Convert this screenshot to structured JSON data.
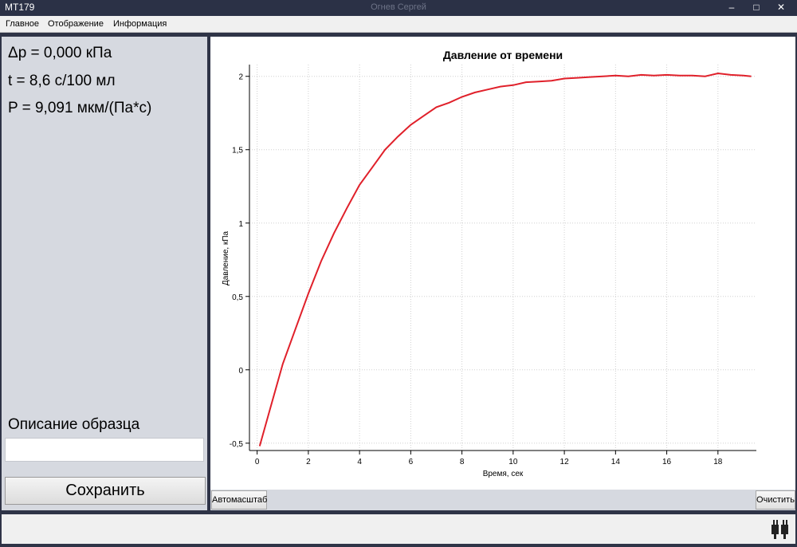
{
  "window": {
    "app_title": "MT179",
    "user": "Огнев Сергей",
    "minimize": "–",
    "maximize": "□",
    "close": "✕"
  },
  "menu": {
    "items": [
      "Главное",
      "Отображение",
      "Информация"
    ]
  },
  "left_panel": {
    "params": [
      "Δp = 0,000 кПа",
      "t = 8,6 с/100 мл",
      "P = 9,091 мкм/(Па*с)"
    ],
    "description_label": "Описание образца",
    "description_value": "",
    "save_label": "Сохранить"
  },
  "chart_buttons": {
    "autoscale": "Автомасштаб",
    "clear": "Очистить"
  },
  "status": {
    "icon": "plug-icon"
  },
  "colors": {
    "series": "#e0202a",
    "title_bar": "#2b3146",
    "panel": "#d6d9e0"
  },
  "chart_data": {
    "type": "line",
    "title": "Давление от времени",
    "xlabel": "Время, сек",
    "ylabel": "Давление, кПа",
    "xlim": [
      -0.3,
      19.5
    ],
    "ylim": [
      -0.55,
      2.08
    ],
    "xticks": [
      0,
      2,
      4,
      6,
      8,
      10,
      12,
      14,
      16,
      18
    ],
    "xtick_labels": [
      "0",
      "2",
      "4",
      "6",
      "8",
      "10",
      "12",
      "14",
      "16",
      "18"
    ],
    "yticks": [
      -0.5,
      0,
      0.5,
      1,
      1.5,
      2
    ],
    "ytick_labels": [
      "-0,5",
      "0",
      "0,5",
      "1",
      "1,5",
      "2"
    ],
    "grid": true,
    "series": [
      {
        "color": "#e0202a",
        "x": [
          0.1,
          0.5,
          1.0,
          1.5,
          2.0,
          2.5,
          3.0,
          3.5,
          4.0,
          4.5,
          5.0,
          5.5,
          6.0,
          6.5,
          7.0,
          7.5,
          8.0,
          8.5,
          9.0,
          9.5,
          10.0,
          10.5,
          11.0,
          11.5,
          12.0,
          12.5,
          13.0,
          13.5,
          14.0,
          14.5,
          15.0,
          15.5,
          16.0,
          16.5,
          17.0,
          17.5,
          18.0,
          18.5,
          19.0,
          19.3
        ],
        "y": [
          -0.52,
          -0.27,
          0.04,
          0.28,
          0.52,
          0.74,
          0.93,
          1.1,
          1.26,
          1.38,
          1.5,
          1.59,
          1.67,
          1.73,
          1.79,
          1.82,
          1.86,
          1.89,
          1.91,
          1.93,
          1.94,
          1.96,
          1.965,
          1.97,
          1.985,
          1.99,
          1.995,
          2.0,
          2.005,
          2.0,
          2.01,
          2.005,
          2.01,
          2.005,
          2.005,
          2.0,
          2.02,
          2.01,
          2.005,
          2.0
        ]
      }
    ]
  }
}
